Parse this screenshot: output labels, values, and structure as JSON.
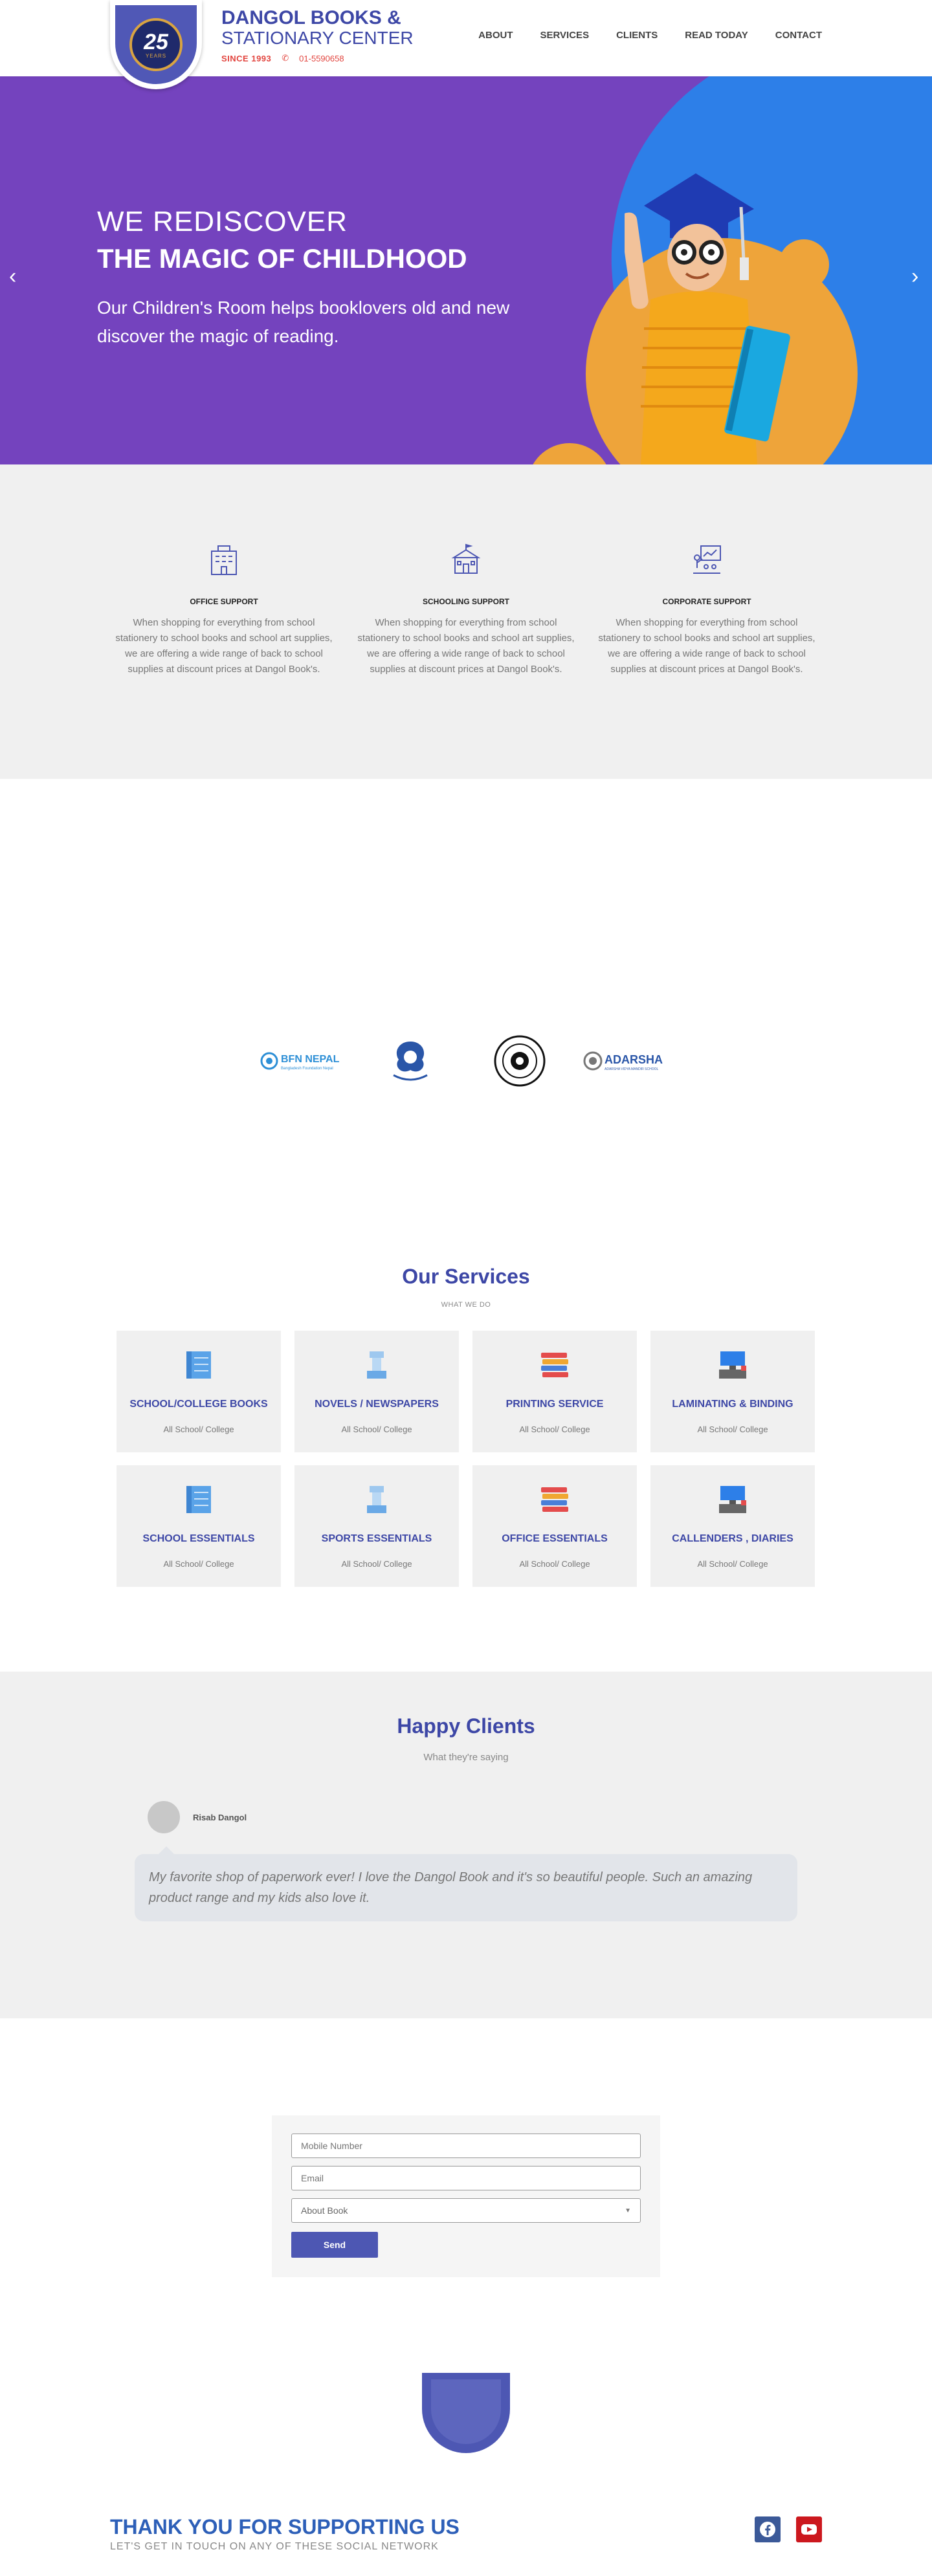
{
  "header": {
    "logo": {
      "number": "25",
      "caption": "YEARS"
    },
    "brand_title": "DANGOL BOOKS &",
    "brand_subtitle": "STATIONARY CENTER",
    "since": "SINCE 1993",
    "phone": "01-5590658",
    "nav": [
      "ABOUT",
      "SERVICES",
      "CLIENTS",
      "READ TODAY",
      "CONTACT"
    ]
  },
  "hero": {
    "line1": "WE REDISCOVER",
    "line2": "THE MAGIC OF CHILDHOOD",
    "line3": "Our Children's Room helps booklovers old and new discover the magic of reading.",
    "prev": "‹",
    "next": "›"
  },
  "features": [
    {
      "title": "OFFICE SUPPORT",
      "text": "When shopping for everything from school stationery to school books and school art supplies, we are offering a wide range of back to school supplies at discount prices at Dangol Book's.",
      "icon": "office-building-icon"
    },
    {
      "title": "SCHOOLING SUPPORT",
      "text": "When shopping for everything from school stationery to school books and school art supplies, we are offering a wide range of back to school supplies at discount prices at Dangol Book's.",
      "icon": "school-building-icon"
    },
    {
      "title": "CORPORATE SUPPORT",
      "text": "When shopping for everything from school stationery to school books and school art supplies, we are offering a wide range of back to school supplies at discount prices at Dangol Book's.",
      "icon": "presentation-board-icon"
    }
  ],
  "partners": [
    {
      "name": "BFN NEPAL",
      "tag": "Bangladesh Foundation Nepal"
    },
    {
      "name": "partner-2"
    },
    {
      "name": "partner-3"
    },
    {
      "name": "ADARSHA",
      "tag": "ADARSHA VIDYA MANDIR SCHOOL"
    }
  ],
  "services": {
    "title": "Our Services",
    "subtitle": "WHAT WE DO",
    "items": [
      {
        "title": "SCHOOL/COLLEGE BOOKS",
        "text": "All School/ College",
        "icon": "book-stack-icon"
      },
      {
        "title": "NOVELS / NEWSPAPERS",
        "text": "All School/ College",
        "icon": "chess-rook-icon"
      },
      {
        "title": "PRINTING SERVICE",
        "text": "All School/ College",
        "icon": "color-books-icon"
      },
      {
        "title": "LAMINATING & BINDING",
        "text": "All School/ College",
        "icon": "computer-desk-icon"
      },
      {
        "title": "SCHOOL ESSENTIALS",
        "text": "All School/ College",
        "icon": "book-stack-icon"
      },
      {
        "title": "SPORTS ESSENTIALS",
        "text": "All School/ College",
        "icon": "chess-rook-icon"
      },
      {
        "title": "OFFICE ESSENTIALS",
        "text": "All School/ College",
        "icon": "color-books-icon"
      },
      {
        "title": "CALLENDERS , DIARIES",
        "text": "All School/ College",
        "icon": "computer-desk-icon"
      }
    ]
  },
  "clients": {
    "title": "Happy Clients",
    "subtitle": "What they're saying",
    "name": "Risab Dangol",
    "quote": "My favorite shop of paperwork ever! I love the Dangol Book and it's so beautiful people. Such an amazing product range and my kids also love it."
  },
  "form": {
    "mobile_placeholder": "Mobile Number",
    "email_placeholder": "Email",
    "select_value": "About Book",
    "send_label": "Send"
  },
  "footer": {
    "title": "THANK YOU FOR SUPPORTING US",
    "subtitle": "LET'S GET IN TOUCH ON ANY OF THESE SOCIAL NETWORK",
    "facebook_color": "#3b5998",
    "youtube_color": "#cc181e"
  },
  "colors": {
    "primary": "#3d47a6",
    "hero_purple": "#7443be",
    "hero_blue": "#2d7fe8",
    "hero_orange": "#eea43a"
  }
}
